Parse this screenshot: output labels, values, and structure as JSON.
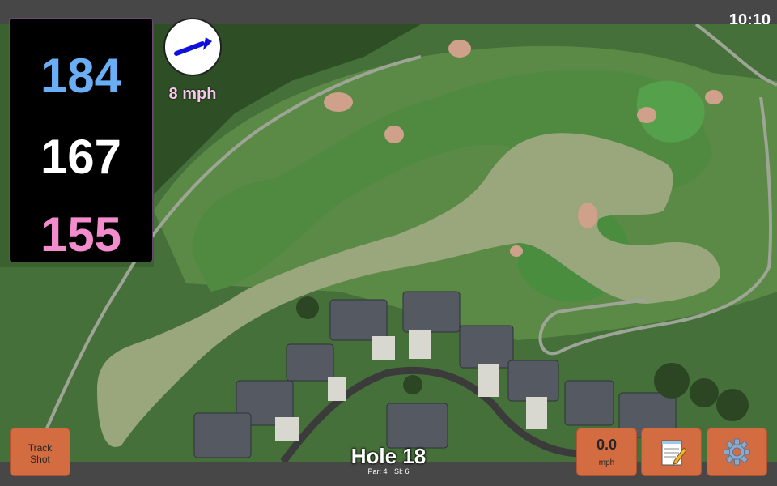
{
  "status_bar": {
    "clock": "10:10"
  },
  "distances": {
    "back": "184",
    "middle": "167",
    "front": "155"
  },
  "wind": {
    "speed": "8 mph",
    "direction_icon": "arrow-up-right-icon"
  },
  "hole": {
    "title": "Hole 18",
    "par": "Par: 4",
    "si": "SI: 6"
  },
  "buttons": {
    "track_shot_line1": "Track",
    "track_shot_line2": "Shot",
    "speed_value": "0.0",
    "speed_unit": "mph",
    "notes_icon": "notepad-icon",
    "settings_icon": "gear-icon"
  },
  "colors": {
    "back_distance": "#6aaef5",
    "middle_distance": "#ffffff",
    "front_distance": "#f28ccd",
    "button": "#d46c41",
    "wind_text": "#f7c6ec"
  }
}
